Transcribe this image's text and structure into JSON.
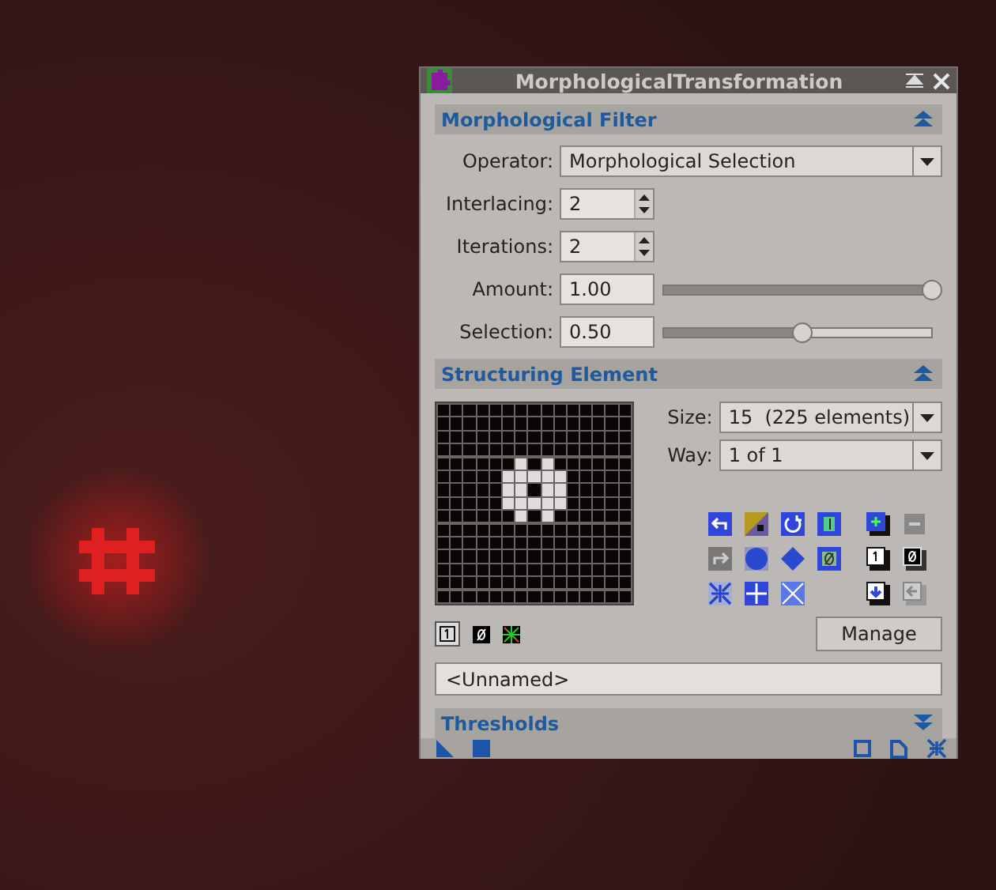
{
  "window": {
    "title": "MorphologicalTransformation"
  },
  "morphological_filter": {
    "title": "Morphological Filter",
    "expanded": true,
    "operator": {
      "label": "Operator:",
      "value": "Morphological Selection"
    },
    "interlacing": {
      "label": "Interlacing:",
      "value": "2"
    },
    "iterations": {
      "label": "Iterations:",
      "value": "2"
    },
    "amount": {
      "label": "Amount:",
      "value": "1.00",
      "level": 1.0
    },
    "selection": {
      "label": "Selection:",
      "value": "0.50",
      "level": 0.5
    }
  },
  "structuring_element": {
    "title": "Structuring Element",
    "expanded": true,
    "size": {
      "label": "Size:",
      "value": "15  (225 elements)"
    },
    "way": {
      "label": "Way:",
      "value": "1 of 1"
    },
    "manage_button": "Manage",
    "name": "<Unnamed>",
    "grid": [
      [
        false,
        false,
        false,
        false,
        false,
        false,
        false,
        false,
        false,
        false,
        false,
        false,
        false,
        false,
        false
      ],
      [
        false,
        false,
        false,
        false,
        false,
        false,
        false,
        false,
        false,
        false,
        false,
        false,
        false,
        false,
        false
      ],
      [
        false,
        false,
        false,
        false,
        false,
        false,
        false,
        false,
        false,
        false,
        false,
        false,
        false,
        false,
        false
      ],
      [
        false,
        false,
        false,
        false,
        false,
        false,
        false,
        false,
        false,
        false,
        false,
        false,
        false,
        false,
        false
      ],
      [
        false,
        false,
        false,
        false,
        false,
        false,
        true,
        false,
        true,
        false,
        false,
        false,
        false,
        false,
        false
      ],
      [
        false,
        false,
        false,
        false,
        false,
        true,
        true,
        true,
        true,
        true,
        false,
        false,
        false,
        false,
        false
      ],
      [
        false,
        false,
        false,
        false,
        false,
        true,
        true,
        false,
        true,
        true,
        false,
        false,
        false,
        false,
        false
      ],
      [
        false,
        false,
        false,
        false,
        false,
        true,
        true,
        true,
        true,
        true,
        false,
        false,
        false,
        false,
        false
      ],
      [
        false,
        false,
        false,
        false,
        false,
        false,
        true,
        false,
        true,
        false,
        false,
        false,
        false,
        false,
        false
      ],
      [
        false,
        false,
        false,
        false,
        false,
        false,
        false,
        false,
        false,
        false,
        false,
        false,
        false,
        false,
        false
      ],
      [
        false,
        false,
        false,
        false,
        false,
        false,
        false,
        false,
        false,
        false,
        false,
        false,
        false,
        false,
        false
      ],
      [
        false,
        false,
        false,
        false,
        false,
        false,
        false,
        false,
        false,
        false,
        false,
        false,
        false,
        false,
        false
      ],
      [
        false,
        false,
        false,
        false,
        false,
        false,
        false,
        false,
        false,
        false,
        false,
        false,
        false,
        false,
        false
      ],
      [
        false,
        false,
        false,
        false,
        false,
        false,
        false,
        false,
        false,
        false,
        false,
        false,
        false,
        false,
        false
      ],
      [
        false,
        false,
        false,
        false,
        false,
        false,
        false,
        false,
        false,
        false,
        false,
        false,
        false,
        false,
        false
      ]
    ]
  },
  "thresholds": {
    "title": "Thresholds",
    "expanded": false
  }
}
